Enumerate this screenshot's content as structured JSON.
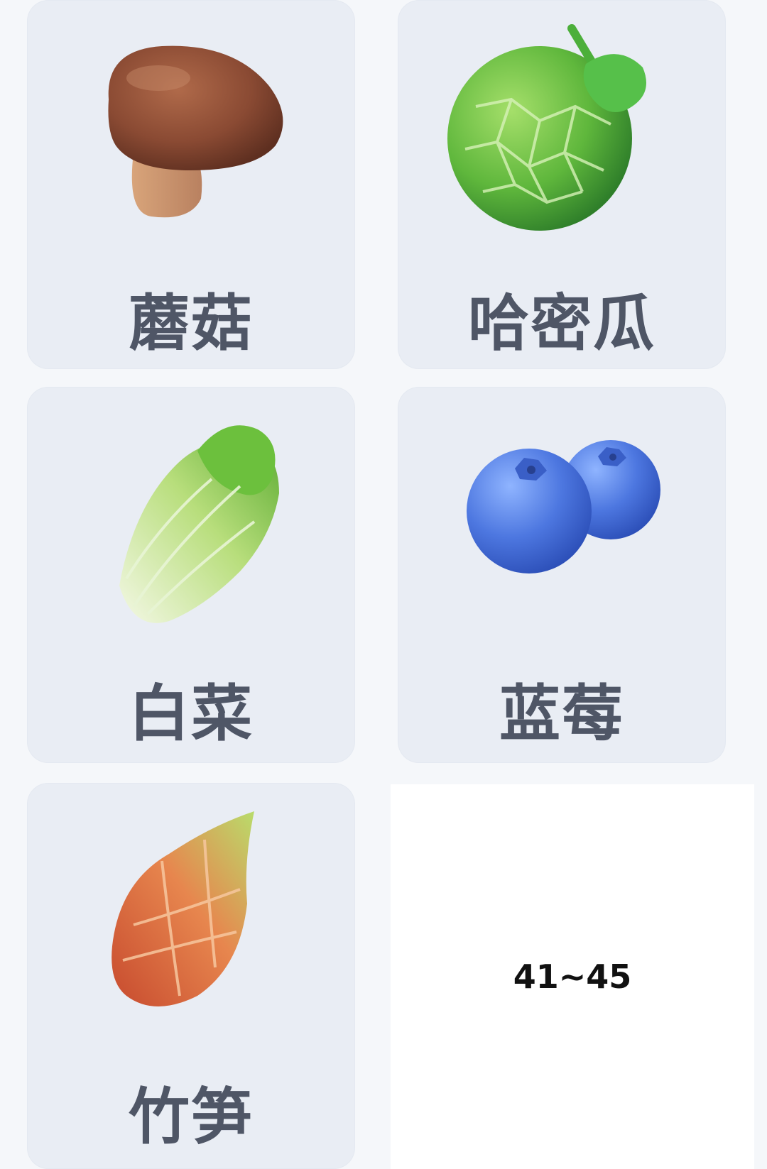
{
  "items": [
    {
      "label": "蘑菇",
      "icon": "mushroom-icon"
    },
    {
      "label": "哈密瓜",
      "icon": "melon-icon"
    },
    {
      "label": "白菜",
      "icon": "cabbage-icon"
    },
    {
      "label": "蓝莓",
      "icon": "blueberry-icon"
    },
    {
      "label": "竹笋",
      "icon": "bamboo-shoot-icon"
    }
  ],
  "range_label": "41~45",
  "colors": {
    "card_bg": "#e9edf4",
    "label_text": "#4f5666",
    "page_bg": "#f5f7fa"
  }
}
